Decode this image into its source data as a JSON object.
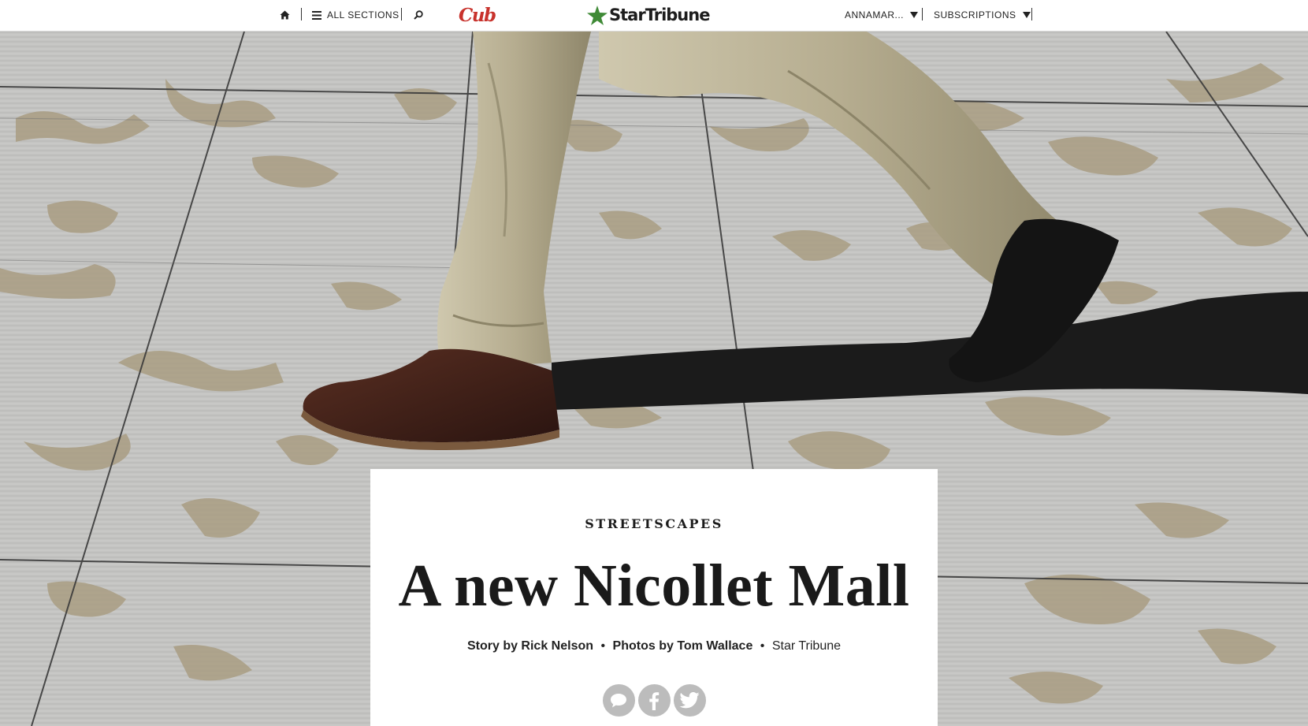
{
  "nav": {
    "home_icon": "home-icon",
    "sections_label": "ALL SECTIONS",
    "search_icon": "search-icon",
    "sponsor_logo": "Cub",
    "brand_logo": "StarTribune",
    "account_label": "ANNAMAR...",
    "subscriptions_label": "SUBSCRIPTIONS"
  },
  "hero": {
    "image_description_icon": "sidewalk-photo"
  },
  "article": {
    "kicker": "STREETSCAPES",
    "headline": "A new Nicollet Mall",
    "byline_story": "Story by Rick Nelson",
    "byline_photos": "Photos by Tom Wallace",
    "byline_outlet": "Star Tribune",
    "separator": "•"
  },
  "share": {
    "comment_icon": "comment-icon",
    "facebook_icon": "facebook-icon",
    "twitter_icon": "twitter-icon"
  },
  "colors": {
    "sponsor_red": "#c8322c",
    "brand_green": "#3f8a36",
    "share_gray": "#bcbcbc"
  }
}
